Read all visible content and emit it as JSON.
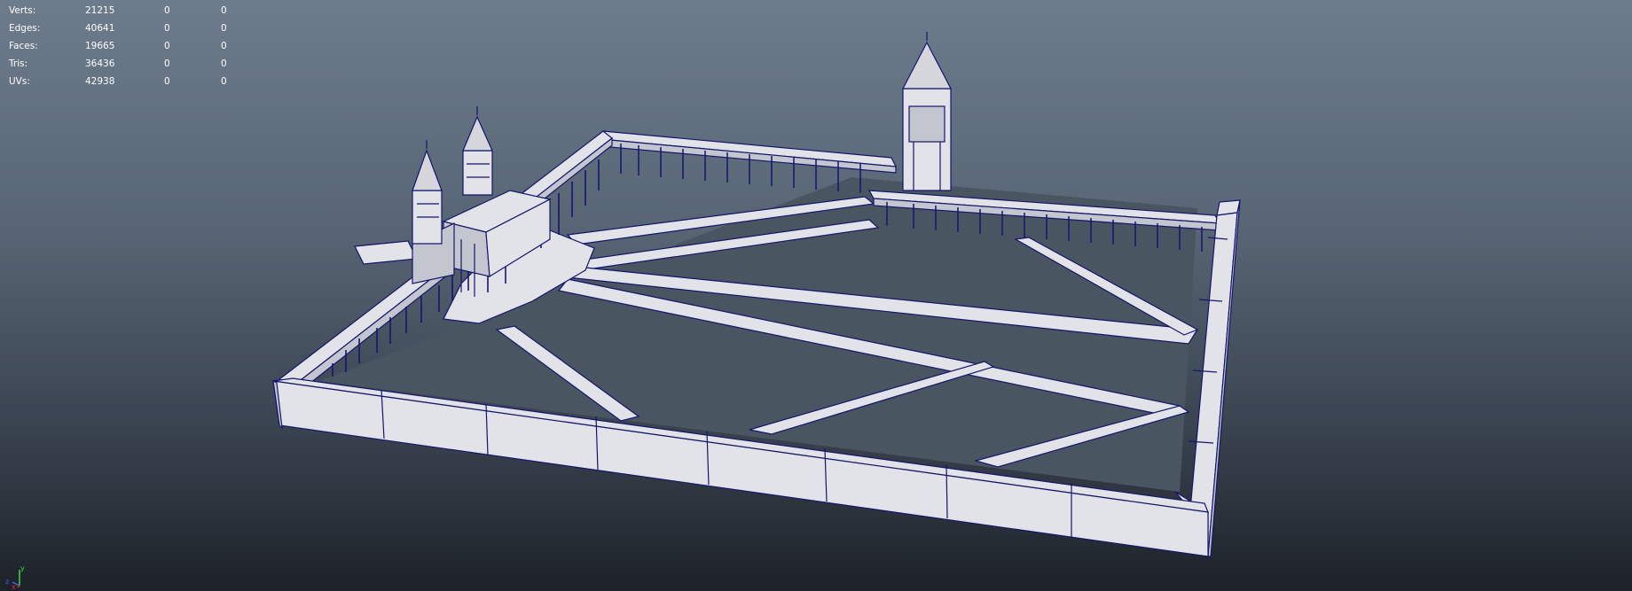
{
  "hud": {
    "rows": [
      {
        "label": "Verts:",
        "total": "21215",
        "selected": "0",
        "components": "0"
      },
      {
        "label": "Edges:",
        "total": "40641",
        "selected": "0",
        "components": "0"
      },
      {
        "label": "Faces:",
        "total": "19665",
        "selected": "0",
        "components": "0"
      },
      {
        "label": "Tris:",
        "total": "36436",
        "selected": "0",
        "components": "0"
      },
      {
        "label": "UVs:",
        "total": "42938",
        "selected": "0",
        "components": "0"
      }
    ]
  },
  "axis": {
    "y": "y",
    "x": "x",
    "z": "z"
  },
  "colors": {
    "wireframe": "#14166b",
    "surface": "#e2e3e8",
    "shade": "#c3c6ce",
    "axis_x": "#e13232",
    "axis_y": "#3fd14b",
    "axis_z": "#3c63e8"
  }
}
